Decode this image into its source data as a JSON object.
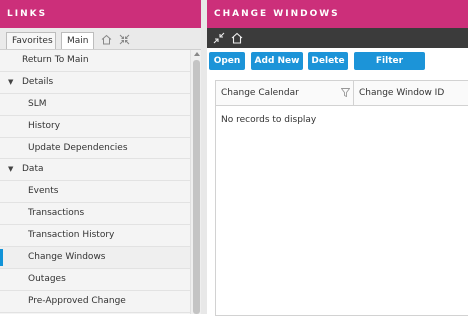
{
  "left_panel": {
    "title": "LINKS",
    "tabs": [
      "Favorites",
      "Main"
    ],
    "items": [
      {
        "label": "Return To Main",
        "kind": "top"
      },
      {
        "label": "Details",
        "kind": "section"
      },
      {
        "label": "SLM",
        "kind": "item"
      },
      {
        "label": "History",
        "kind": "item"
      },
      {
        "label": "Update Dependencies",
        "kind": "item"
      },
      {
        "label": "Data",
        "kind": "section"
      },
      {
        "label": "Events",
        "kind": "item"
      },
      {
        "label": "Transactions",
        "kind": "item"
      },
      {
        "label": "Transaction History",
        "kind": "item"
      },
      {
        "label": "Change Windows",
        "kind": "item",
        "selected": true
      },
      {
        "label": "Outages",
        "kind": "item"
      },
      {
        "label": "Pre-Approved Change",
        "kind": "item"
      }
    ]
  },
  "right_panel": {
    "title": "CHANGE WINDOWS",
    "buttons": [
      "Open",
      "Add New",
      "Delete",
      "Filter Columns"
    ],
    "columns": [
      "Change Calendar",
      "Change Window ID"
    ],
    "empty_message": "No records to display"
  },
  "colors": {
    "header": "#cc2f7a",
    "button": "#1c94d8",
    "toolbar": "#3b3b3b",
    "selection": "#1193d8"
  }
}
